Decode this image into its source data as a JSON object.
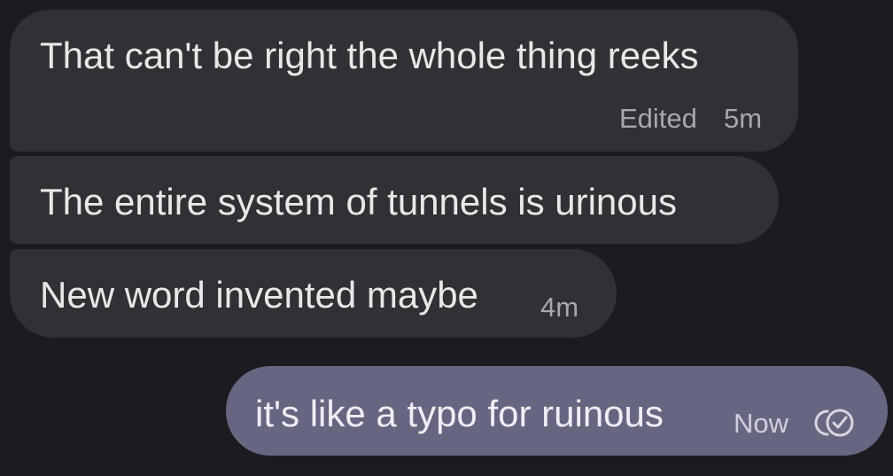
{
  "messages": [
    {
      "direction": "incoming",
      "text": "That can't be right the whole thing reeks",
      "edited_label": "Edited",
      "time": "5m"
    },
    {
      "direction": "incoming",
      "text": "The entire system of tunnels is urinous"
    },
    {
      "direction": "incoming",
      "text": "New word invented maybe",
      "time": "4m"
    },
    {
      "direction": "outgoing",
      "text": "it's like a typo for ruinous",
      "time": "Now",
      "status_icon": "read-receipt-icon"
    }
  ],
  "colors": {
    "background": "#1b1c20",
    "incoming_bubble": "#303134",
    "outgoing_bubble": "#676681",
    "text": "#e8e8ea",
    "meta_text": "#a7a8ad"
  }
}
